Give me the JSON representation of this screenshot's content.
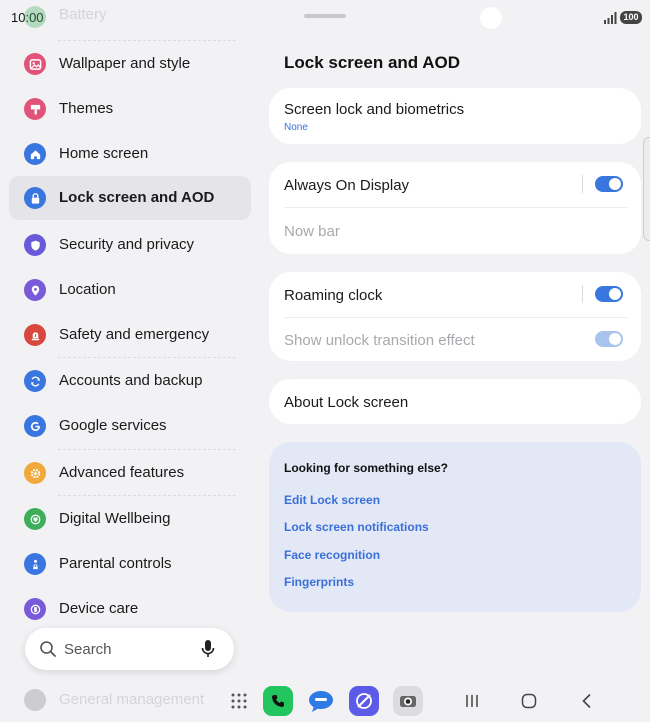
{
  "status_bar": {
    "time": "10:00",
    "battery": "100"
  },
  "sidebar": {
    "top_partial": "Battery",
    "items": [
      {
        "label": "Wallpaper and style",
        "color": "#e2537a",
        "icon": "wallpaper-icon"
      },
      {
        "label": "Themes",
        "color": "#e2537a",
        "icon": "brush-icon"
      },
      {
        "label": "Home screen",
        "color": "#3a76e0",
        "icon": "home-icon"
      },
      {
        "label": "Lock screen and AOD",
        "color": "#3a76e0",
        "icon": "lock-icon",
        "active": true
      },
      {
        "label": "Security and privacy",
        "color": "#6a5ad9",
        "icon": "shield-icon"
      },
      {
        "label": "Location",
        "color": "#7a5ad9",
        "icon": "location-pin-icon"
      },
      {
        "label": "Safety and emergency",
        "color": "#d8483f",
        "icon": "emergency-icon"
      },
      {
        "label": "Accounts and backup",
        "color": "#3a76e0",
        "icon": "sync-icon"
      },
      {
        "label": "Google services",
        "color": "#3a76e0",
        "icon": "google-g-icon"
      },
      {
        "label": "Advanced features",
        "color": "#f0a93a",
        "icon": "gear-plus-icon"
      },
      {
        "label": "Digital Wellbeing",
        "color": "#3fae5a",
        "icon": "wellbeing-heart-icon"
      },
      {
        "label": "Parental controls",
        "color": "#3a76e0",
        "icon": "parent-child-icon"
      },
      {
        "label": "Device care",
        "color": "#7a5ad9",
        "icon": "device-care-icon"
      }
    ],
    "bottom_partial": "General management"
  },
  "search": {
    "placeholder": "Search"
  },
  "main": {
    "title": "Lock screen and AOD",
    "screen_lock": {
      "title": "Screen lock and biometrics",
      "subtitle": "None"
    },
    "aod": {
      "title": "Always On Display",
      "toggle": "on"
    },
    "now_bar": {
      "title": "Now bar"
    },
    "roaming_clock": {
      "title": "Roaming clock",
      "toggle": "on"
    },
    "unlock_effect": {
      "title": "Show unlock transition effect",
      "toggle": "on-disabled"
    },
    "about": {
      "title": "About Lock screen"
    },
    "looking": {
      "title": "Looking for something else?",
      "links": [
        "Edit Lock screen",
        "Lock screen notifications",
        "Face recognition",
        "Fingerprints"
      ]
    }
  },
  "taskbar": {
    "apps": [
      {
        "name": "Phone",
        "color": "#22c55e"
      },
      {
        "name": "Messages",
        "color": "#2f7be6"
      },
      {
        "name": "Internet",
        "color": "#5b5be8"
      },
      {
        "name": "Camera",
        "color": "#c9c9cf"
      }
    ]
  }
}
